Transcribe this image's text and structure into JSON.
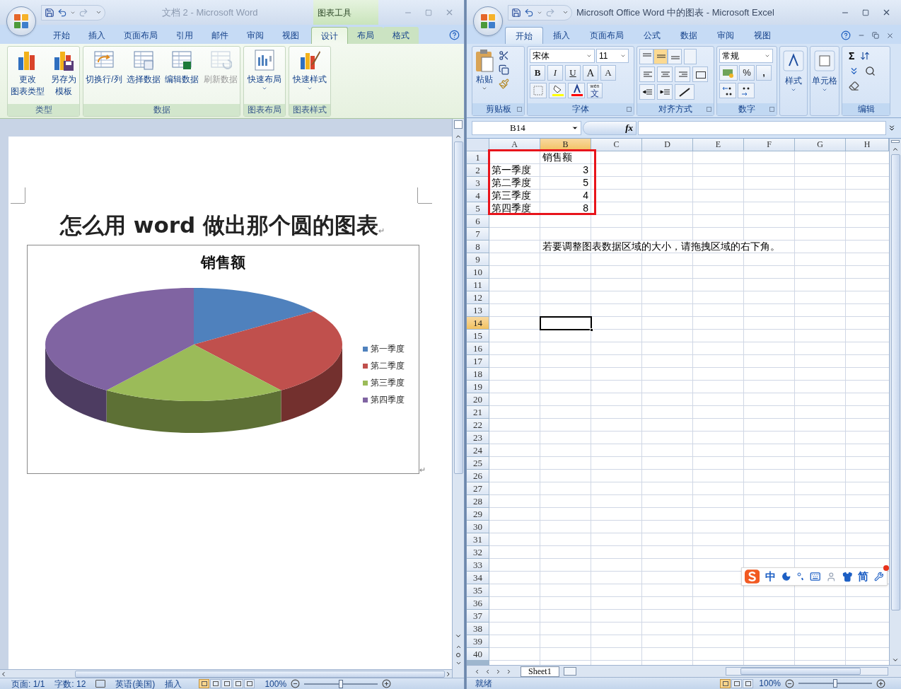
{
  "word": {
    "title": "文档 2 - Microsoft Word",
    "context_header": "图表工具",
    "tabs": [
      {
        "label": "开始",
        "selected": false,
        "contextual": false
      },
      {
        "label": "插入",
        "selected": false,
        "contextual": false
      },
      {
        "label": "页面布局",
        "selected": false,
        "contextual": false
      },
      {
        "label": "引用",
        "selected": false,
        "contextual": false
      },
      {
        "label": "邮件",
        "selected": false,
        "contextual": false
      },
      {
        "label": "审阅",
        "selected": false,
        "contextual": false
      },
      {
        "label": "视图",
        "selected": false,
        "contextual": false
      },
      {
        "label": "设计",
        "selected": true,
        "contextual": true
      },
      {
        "label": "布局",
        "selected": false,
        "contextual": true
      },
      {
        "label": "格式",
        "selected": false,
        "contextual": true
      }
    ],
    "ribbon_groups": [
      {
        "label": "类型",
        "buttons": [
          {
            "lines": [
              "更改",
              "图表类型"
            ],
            "disabled": false,
            "dropdown": false
          },
          {
            "lines": [
              "另存为",
              "模板"
            ],
            "disabled": false,
            "dropdown": false
          }
        ]
      },
      {
        "label": "数据",
        "buttons": [
          {
            "lines": [
              "切换行/列"
            ],
            "disabled": false,
            "dropdown": false
          },
          {
            "lines": [
              "选择数据"
            ],
            "disabled": false,
            "dropdown": false
          },
          {
            "lines": [
              "编辑数据"
            ],
            "disabled": false,
            "dropdown": false
          },
          {
            "lines": [
              "刷新数据"
            ],
            "disabled": true,
            "dropdown": false
          }
        ]
      },
      {
        "label": "图表布局",
        "buttons": [
          {
            "lines": [
              "快速布局"
            ],
            "disabled": false,
            "dropdown": true
          }
        ]
      },
      {
        "label": "图表样式",
        "buttons": [
          {
            "lines": [
              "快速样式"
            ],
            "disabled": false,
            "dropdown": true
          }
        ]
      }
    ],
    "document": {
      "heading": "怎么用 word 做出那个圆的图表",
      "heading_mark": "↵",
      "chart_mark": "↵",
      "chart": {
        "title": "销售额",
        "legend": [
          {
            "label": "第一季度",
            "color": "#4f81bd"
          },
          {
            "label": "第二季度",
            "color": "#c0504d"
          },
          {
            "label": "第三季度",
            "color": "#9bbb59"
          },
          {
            "label": "第四季度",
            "color": "#8064a2"
          }
        ]
      }
    },
    "status_bar": {
      "page": "页面: 1/1",
      "words": "字数: 12",
      "language": "英语(美国)",
      "mode": "插入",
      "zoom": "100%",
      "level": 0.5,
      "views": [
        {
          "selected": true
        },
        {
          "selected": false
        },
        {
          "selected": false
        },
        {
          "selected": false
        },
        {
          "selected": false
        }
      ]
    }
  },
  "excel": {
    "title": "Microsoft Office Word 中的图表 - Microsoft Excel",
    "tabs": [
      {
        "label": "开始",
        "selected": true
      },
      {
        "label": "插入",
        "selected": false
      },
      {
        "label": "页面布局",
        "selected": false
      },
      {
        "label": "公式",
        "selected": false
      },
      {
        "label": "数据",
        "selected": false
      },
      {
        "label": "审阅",
        "selected": false
      },
      {
        "label": "视图",
        "selected": false
      }
    ],
    "clipboard": {
      "label": "剪贴板",
      "paste": "粘贴"
    },
    "font": {
      "label": "字体",
      "name": "宋体",
      "size": "11",
      "bold": "B",
      "italic": "I",
      "underline": "U",
      "grow": "A",
      "shrink": "A",
      "phonetic_top": "wén",
      "phonetic_bottom": "文"
    },
    "alignment": {
      "label": "对齐方式",
      "vertical": [
        {
          "selected": false
        },
        {
          "selected": true
        },
        {
          "selected": false
        }
      ]
    },
    "number": {
      "label": "数字",
      "format": "常规",
      "percent": "%",
      "comma": ","
    },
    "styles": {
      "label": "样式"
    },
    "cells": {
      "label": "单元格"
    },
    "editing": {
      "label": "编辑",
      "sum": "Σ"
    },
    "name_box": "B14",
    "fx": "fx",
    "columns": [
      {
        "label": "A",
        "selected": false
      },
      {
        "label": "B",
        "selected": true
      },
      {
        "label": "C",
        "selected": false
      },
      {
        "label": "D",
        "selected": false
      },
      {
        "label": "E",
        "selected": false
      },
      {
        "label": "F",
        "selected": false
      },
      {
        "label": "G",
        "selected": false
      },
      {
        "label": "H",
        "selected": false
      }
    ],
    "rows": [
      {
        "header": "1",
        "selected": false,
        "cells": [
          null,
          {
            "text": "销售额",
            "kind": "text"
          }
        ]
      },
      {
        "header": "2",
        "selected": false,
        "cells": [
          {
            "text": "第一季度",
            "kind": "text"
          },
          {
            "text": "3",
            "kind": "number"
          }
        ]
      },
      {
        "header": "3",
        "selected": false,
        "cells": [
          {
            "text": "第二季度",
            "kind": "text"
          },
          {
            "text": "5",
            "kind": "number"
          }
        ]
      },
      {
        "header": "4",
        "selected": false,
        "cells": [
          {
            "text": "第三季度",
            "kind": "text"
          },
          {
            "text": "4",
            "kind": "number"
          }
        ]
      },
      {
        "header": "5",
        "selected": false,
        "cells": [
          {
            "text": "第四季度",
            "kind": "text"
          },
          {
            "text": "8",
            "kind": "number"
          }
        ]
      },
      {
        "header": "6",
        "selected": false
      },
      {
        "header": "7",
        "selected": false
      },
      {
        "header": "8",
        "selected": false,
        "cells": [
          null,
          {
            "text": "若要调整图表数据区域的大小，请拖拽区域的右下角。",
            "kind": "text"
          }
        ]
      },
      {
        "header": "9",
        "selected": false
      },
      {
        "header": "10",
        "selected": false
      },
      {
        "header": "11",
        "selected": false
      },
      {
        "header": "12",
        "selected": false
      },
      {
        "header": "13",
        "selected": false
      },
      {
        "header": "14",
        "selected": true
      },
      {
        "header": "15",
        "selected": false
      },
      {
        "header": "16",
        "selected": false
      },
      {
        "header": "17",
        "selected": false
      },
      {
        "header": "18",
        "selected": false
      },
      {
        "header": "19",
        "selected": false
      },
      {
        "header": "20",
        "selected": false
      },
      {
        "header": "21",
        "selected": false
      },
      {
        "header": "22",
        "selected": false
      },
      {
        "header": "23",
        "selected": false
      },
      {
        "header": "24",
        "selected": false
      },
      {
        "header": "25",
        "selected": false
      },
      {
        "header": "26",
        "selected": false
      },
      {
        "header": "27",
        "selected": false
      },
      {
        "header": "28",
        "selected": false
      },
      {
        "header": "29",
        "selected": false
      },
      {
        "header": "30",
        "selected": false
      },
      {
        "header": "31",
        "selected": false
      },
      {
        "header": "32",
        "selected": false
      },
      {
        "header": "33",
        "selected": false
      },
      {
        "header": "34",
        "selected": false
      },
      {
        "header": "35",
        "selected": false
      },
      {
        "header": "36",
        "selected": false
      },
      {
        "header": "37",
        "selected": false
      },
      {
        "header": "38",
        "selected": false
      },
      {
        "header": "39",
        "selected": false
      },
      {
        "header": "40",
        "selected": false
      }
    ],
    "sheet_tab": "Sheet1",
    "status_bar": {
      "status": "就绪",
      "zoom": "100%",
      "level": 0.5,
      "views": [
        {
          "selected": true
        },
        {
          "selected": false
        },
        {
          "selected": false
        }
      ]
    },
    "ime": {
      "mode": "中",
      "script": "简"
    }
  }
}
